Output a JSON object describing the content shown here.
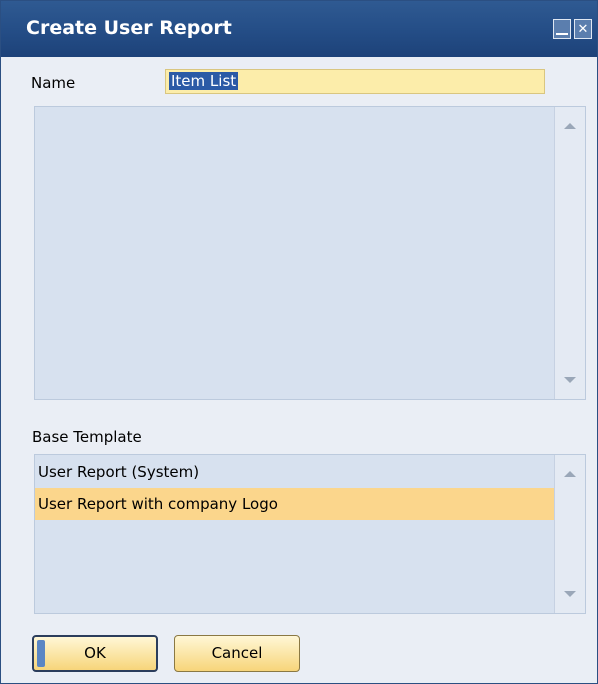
{
  "window": {
    "title": "Create User Report",
    "minimize_icon": "minimize-icon",
    "close_icon": "close-icon"
  },
  "form": {
    "name_label": "Name",
    "name_value": "Item List"
  },
  "base_template": {
    "label": "Base Template",
    "items": [
      {
        "label": "User Report (System)",
        "selected": false
      },
      {
        "label": "User Report with company Logo",
        "selected": true
      }
    ]
  },
  "buttons": {
    "ok_label": "OK",
    "cancel_label": "Cancel"
  },
  "colors": {
    "title_bar": "#244d86",
    "field_highlight": "#fcedaa",
    "selected_row": "#fbd68c",
    "panel": "#d7e1ef"
  }
}
